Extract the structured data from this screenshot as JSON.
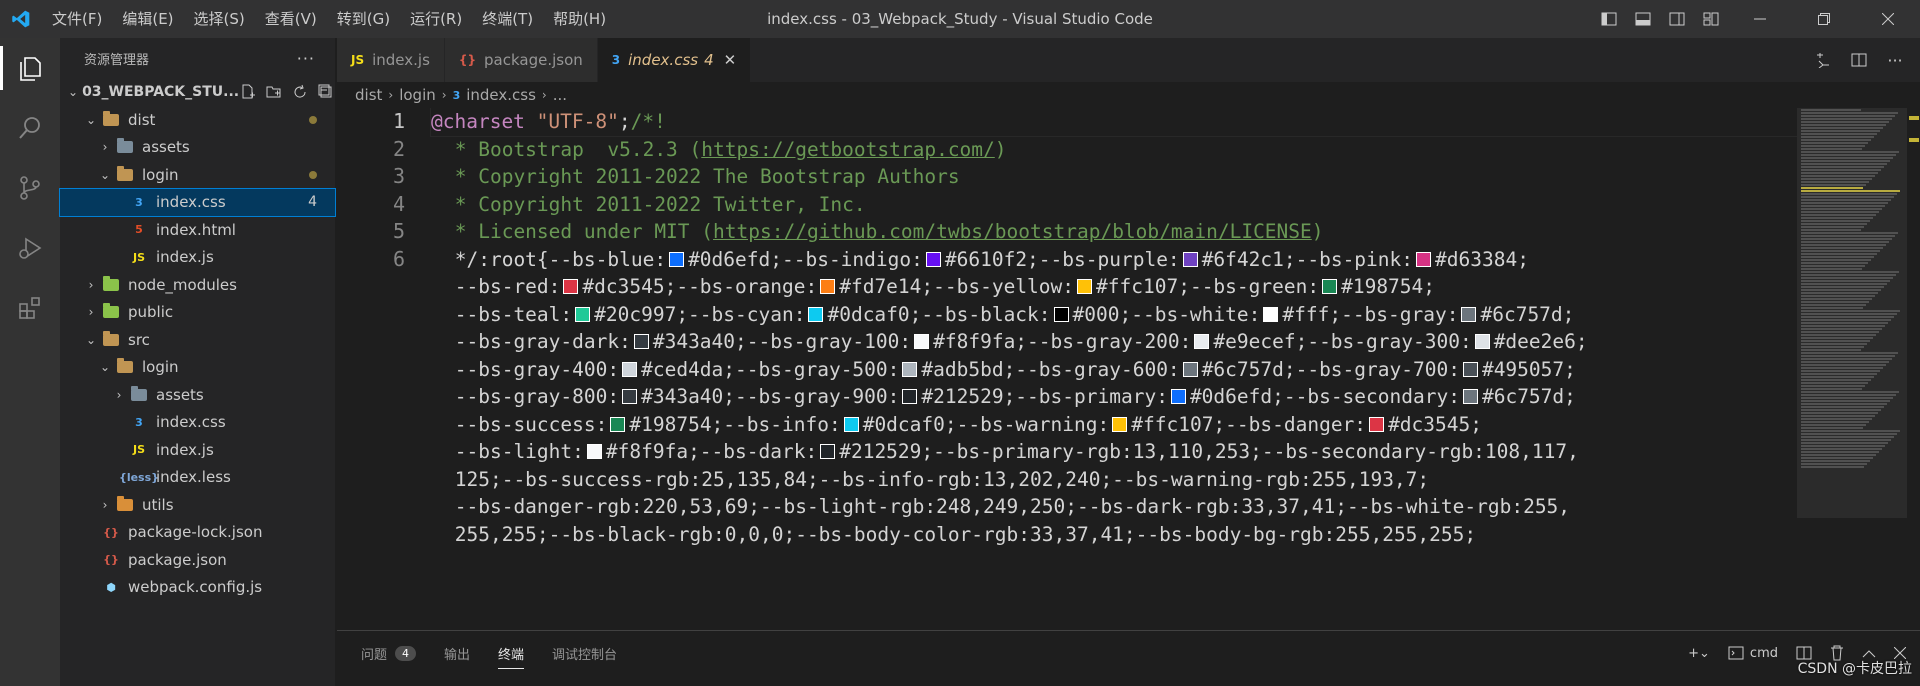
{
  "window": {
    "title": "index.css - 03_Webpack_Study - Visual Studio Code",
    "menu": [
      "文件(F)",
      "编辑(E)",
      "选择(S)",
      "查看(V)",
      "转到(G)",
      "运行(R)",
      "终端(T)",
      "帮助(H)"
    ]
  },
  "sidebar": {
    "title": "资源管理器",
    "more": "···",
    "project": "03_WEBPACK_STU...",
    "tree": [
      {
        "label": "dist",
        "type": "folder",
        "depth": 1,
        "open": true,
        "dot": true
      },
      {
        "label": "assets",
        "type": "folder-special",
        "depth": 2,
        "open": false
      },
      {
        "label": "login",
        "type": "folder",
        "depth": 2,
        "open": true,
        "dot": true
      },
      {
        "label": "index.css",
        "type": "css",
        "depth": 3,
        "selected": true,
        "count": "4"
      },
      {
        "label": "index.html",
        "type": "html",
        "depth": 3
      },
      {
        "label": "index.js",
        "type": "js",
        "depth": 3
      },
      {
        "label": "node_modules",
        "type": "folder-green",
        "depth": 1,
        "open": false
      },
      {
        "label": "public",
        "type": "folder-green",
        "depth": 1,
        "open": false
      },
      {
        "label": "src",
        "type": "folder-src",
        "depth": 1,
        "open": true
      },
      {
        "label": "login",
        "type": "folder",
        "depth": 2,
        "open": true
      },
      {
        "label": "assets",
        "type": "folder-special",
        "depth": 3,
        "open": false
      },
      {
        "label": "index.css",
        "type": "css",
        "depth": 3
      },
      {
        "label": "index.js",
        "type": "js",
        "depth": 3
      },
      {
        "label": "index.less",
        "type": "less",
        "depth": 3
      },
      {
        "label": "utils",
        "type": "folder-util",
        "depth": 2,
        "open": false
      },
      {
        "label": "package-lock.json",
        "type": "json",
        "depth": 1
      },
      {
        "label": "package.json",
        "type": "json",
        "depth": 1
      },
      {
        "label": "webpack.config.js",
        "type": "webpack",
        "depth": 1
      }
    ]
  },
  "tabs": [
    {
      "icon": "JS",
      "label": "index.js",
      "active": false
    },
    {
      "icon": "{}",
      "label": "package.json",
      "active": false
    },
    {
      "icon": "3",
      "label": "index.css",
      "active": true,
      "count": "4",
      "close": "✕"
    }
  ],
  "breadcrumb": [
    "dist",
    "login",
    "index.css",
    "..."
  ],
  "code": {
    "line_numbers": [
      "1",
      "2",
      "3",
      "4",
      "5",
      "6",
      "",
      "",
      "",
      "",
      "",
      "",
      "",
      "",
      ""
    ],
    "lines": [
      [
        {
          "t": "@charset ",
          "c": "kw"
        },
        {
          "t": "\"UTF-8\"",
          "c": "str"
        },
        {
          "t": ";",
          "c": ""
        },
        {
          "t": "/*!",
          "c": "cm"
        }
      ],
      [
        {
          "t": " * Bootstrap  v5.2.3 (",
          "c": "cm"
        },
        {
          "t": "https://getbootstrap.com/",
          "c": "cm url"
        },
        {
          "t": ")",
          "c": "cm"
        }
      ],
      [
        {
          "t": " * Copyright 2011-2022 The Bootstrap Authors",
          "c": "cm"
        }
      ],
      [
        {
          "t": " * Copyright 2011-2022 Twitter, Inc.",
          "c": "cm"
        }
      ],
      [
        {
          "t": " * Licensed under MIT (",
          "c": "cm"
        },
        {
          "t": "https://github.com/twbs/bootstrap/blob/main/LICENSE",
          "c": "cm url"
        },
        {
          "t": ")",
          "c": "cm"
        }
      ],
      [
        {
          "t": " */:root{--bs-blue:",
          "c": ""
        },
        {
          "sw": "#0d6efd"
        },
        {
          "t": "#0d6efd;--bs-indigo:",
          "c": ""
        },
        {
          "sw": "#6610f2"
        },
        {
          "t": "#6610f2;--bs-purple:",
          "c": ""
        },
        {
          "sw": "#6f42c1"
        },
        {
          "t": "#6f42c1;--bs-pink:",
          "c": ""
        },
        {
          "sw": "#d63384"
        },
        {
          "t": "#d63384;",
          "c": ""
        }
      ],
      [
        {
          "t": " --bs-red:",
          "c": ""
        },
        {
          "sw": "#dc3545"
        },
        {
          "t": "#dc3545;--bs-orange:",
          "c": ""
        },
        {
          "sw": "#fd7e14"
        },
        {
          "t": "#fd7e14;--bs-yellow:",
          "c": ""
        },
        {
          "sw": "#ffc107"
        },
        {
          "t": "#ffc107;--bs-green:",
          "c": ""
        },
        {
          "sw": "#198754"
        },
        {
          "t": "#198754;",
          "c": ""
        }
      ],
      [
        {
          "t": " --bs-teal:",
          "c": ""
        },
        {
          "sw": "#20c997"
        },
        {
          "t": "#20c997;--bs-cyan:",
          "c": ""
        },
        {
          "sw": "#0dcaf0"
        },
        {
          "t": "#0dcaf0;--bs-black:",
          "c": ""
        },
        {
          "sw": "#000000"
        },
        {
          "t": "#000;--bs-white:",
          "c": ""
        },
        {
          "sw": "#ffffff"
        },
        {
          "t": "#fff;--bs-gray:",
          "c": ""
        },
        {
          "sw": "#6c757d"
        },
        {
          "t": "#6c757d;",
          "c": ""
        }
      ],
      [
        {
          "t": " --bs-gray-dark:",
          "c": ""
        },
        {
          "sw": "#343a40"
        },
        {
          "t": "#343a40;--bs-gray-100:",
          "c": ""
        },
        {
          "sw": "#f8f9fa"
        },
        {
          "t": "#f8f9fa;--bs-gray-200:",
          "c": ""
        },
        {
          "sw": "#e9ecef"
        },
        {
          "t": "#e9ecef;--bs-gray-300:",
          "c": ""
        },
        {
          "sw": "#dee2e6"
        },
        {
          "t": "#dee2e6;",
          "c": ""
        }
      ],
      [
        {
          "t": " --bs-gray-400:",
          "c": ""
        },
        {
          "sw": "#ced4da"
        },
        {
          "t": "#ced4da;--bs-gray-500:",
          "c": ""
        },
        {
          "sw": "#adb5bd"
        },
        {
          "t": "#adb5bd;--bs-gray-600:",
          "c": ""
        },
        {
          "sw": "#6c757d"
        },
        {
          "t": "#6c757d;--bs-gray-700:",
          "c": ""
        },
        {
          "sw": "#495057"
        },
        {
          "t": "#495057;",
          "c": ""
        }
      ],
      [
        {
          "t": " --bs-gray-800:",
          "c": ""
        },
        {
          "sw": "#343a40"
        },
        {
          "t": "#343a40;--bs-gray-900:",
          "c": ""
        },
        {
          "sw": "#212529"
        },
        {
          "t": "#212529;--bs-primary:",
          "c": ""
        },
        {
          "sw": "#0d6efd"
        },
        {
          "t": "#0d6efd;--bs-secondary:",
          "c": ""
        },
        {
          "sw": "#6c757d"
        },
        {
          "t": "#6c757d;",
          "c": ""
        }
      ],
      [
        {
          "t": " --bs-success:",
          "c": ""
        },
        {
          "sw": "#198754"
        },
        {
          "t": "#198754;--bs-info:",
          "c": ""
        },
        {
          "sw": "#0dcaf0"
        },
        {
          "t": "#0dcaf0;--bs-warning:",
          "c": ""
        },
        {
          "sw": "#ffc107"
        },
        {
          "t": "#ffc107;--bs-danger:",
          "c": ""
        },
        {
          "sw": "#dc3545"
        },
        {
          "t": "#dc3545;",
          "c": ""
        }
      ],
      [
        {
          "t": " --bs-light:",
          "c": ""
        },
        {
          "sw": "#f8f9fa"
        },
        {
          "t": "#f8f9fa;--bs-dark:",
          "c": ""
        },
        {
          "sw": "#212529"
        },
        {
          "t": "#212529;--bs-primary-rgb:13,110,253;--bs-secondary-rgb:108,117,",
          "c": ""
        }
      ],
      [
        {
          "t": " 125;--bs-success-rgb:25,135,84;--bs-info-rgb:13,202,240;--bs-warning-rgb:255,193,7;",
          "c": ""
        }
      ],
      [
        {
          "t": " --bs-danger-rgb:220,53,69;--bs-light-rgb:248,249,250;--bs-dark-rgb:33,37,41;--bs-white-rgb:255,",
          "c": ""
        }
      ],
      [
        {
          "t": " 255,255;--bs-black-rgb:0,0,0;--bs-body-color-rgb:33,37,41;--bs-body-bg-rgb:255,255,255;",
          "c": ""
        }
      ]
    ]
  },
  "panel": {
    "tabs": [
      {
        "label": "问题",
        "badge": "4"
      },
      {
        "label": "输出"
      },
      {
        "label": "终端",
        "active": true
      },
      {
        "label": "调试控制台"
      }
    ],
    "add": "+",
    "terminal_name": "cmd"
  },
  "watermark": "CSDN @卡皮巴拉",
  "colors": {
    "accent": "#007fd4",
    "titlebar": "#323233",
    "activitybar": "#333333",
    "sidebar": "#252526",
    "editor": "#1e1e1e"
  }
}
